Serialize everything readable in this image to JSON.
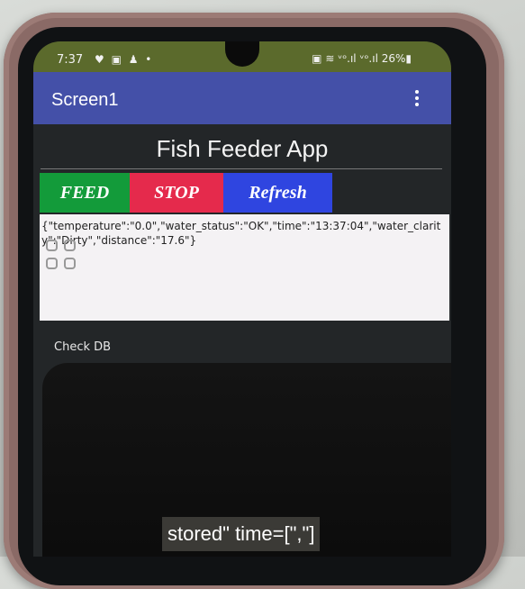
{
  "status_bar": {
    "time": "7:37",
    "left_icons": "♥ ▣ ♟ •",
    "right_text": "▣ ≋ ᵛᵒ.ıl ᵛᵒ.ıl 26%▮"
  },
  "app_bar": {
    "title": "Screen1"
  },
  "main": {
    "heading": "Fish Feeder App",
    "buttons": {
      "feed": "FEED",
      "stop": "STOP",
      "refresh": "Refresh"
    },
    "output_text": "{\"temperature\":\"0.0\",\"water_status\":\"OK\",\"time\":\"13:37:04\",\"water_clarity\":\"Dirty\",\"distance\":\"17.6\"}",
    "check_db_label": "Check DB"
  },
  "caption": "stored\" time=[\",\"]",
  "colors": {
    "feed": "#139b3a",
    "stop": "#e52a4c",
    "refresh": "#2f45e0",
    "app_bar": "#4450a8",
    "status_bar": "#5b6a2c"
  },
  "icons": [
    "overflow-menu-icon",
    "grid-icon",
    "camera-notch"
  ]
}
